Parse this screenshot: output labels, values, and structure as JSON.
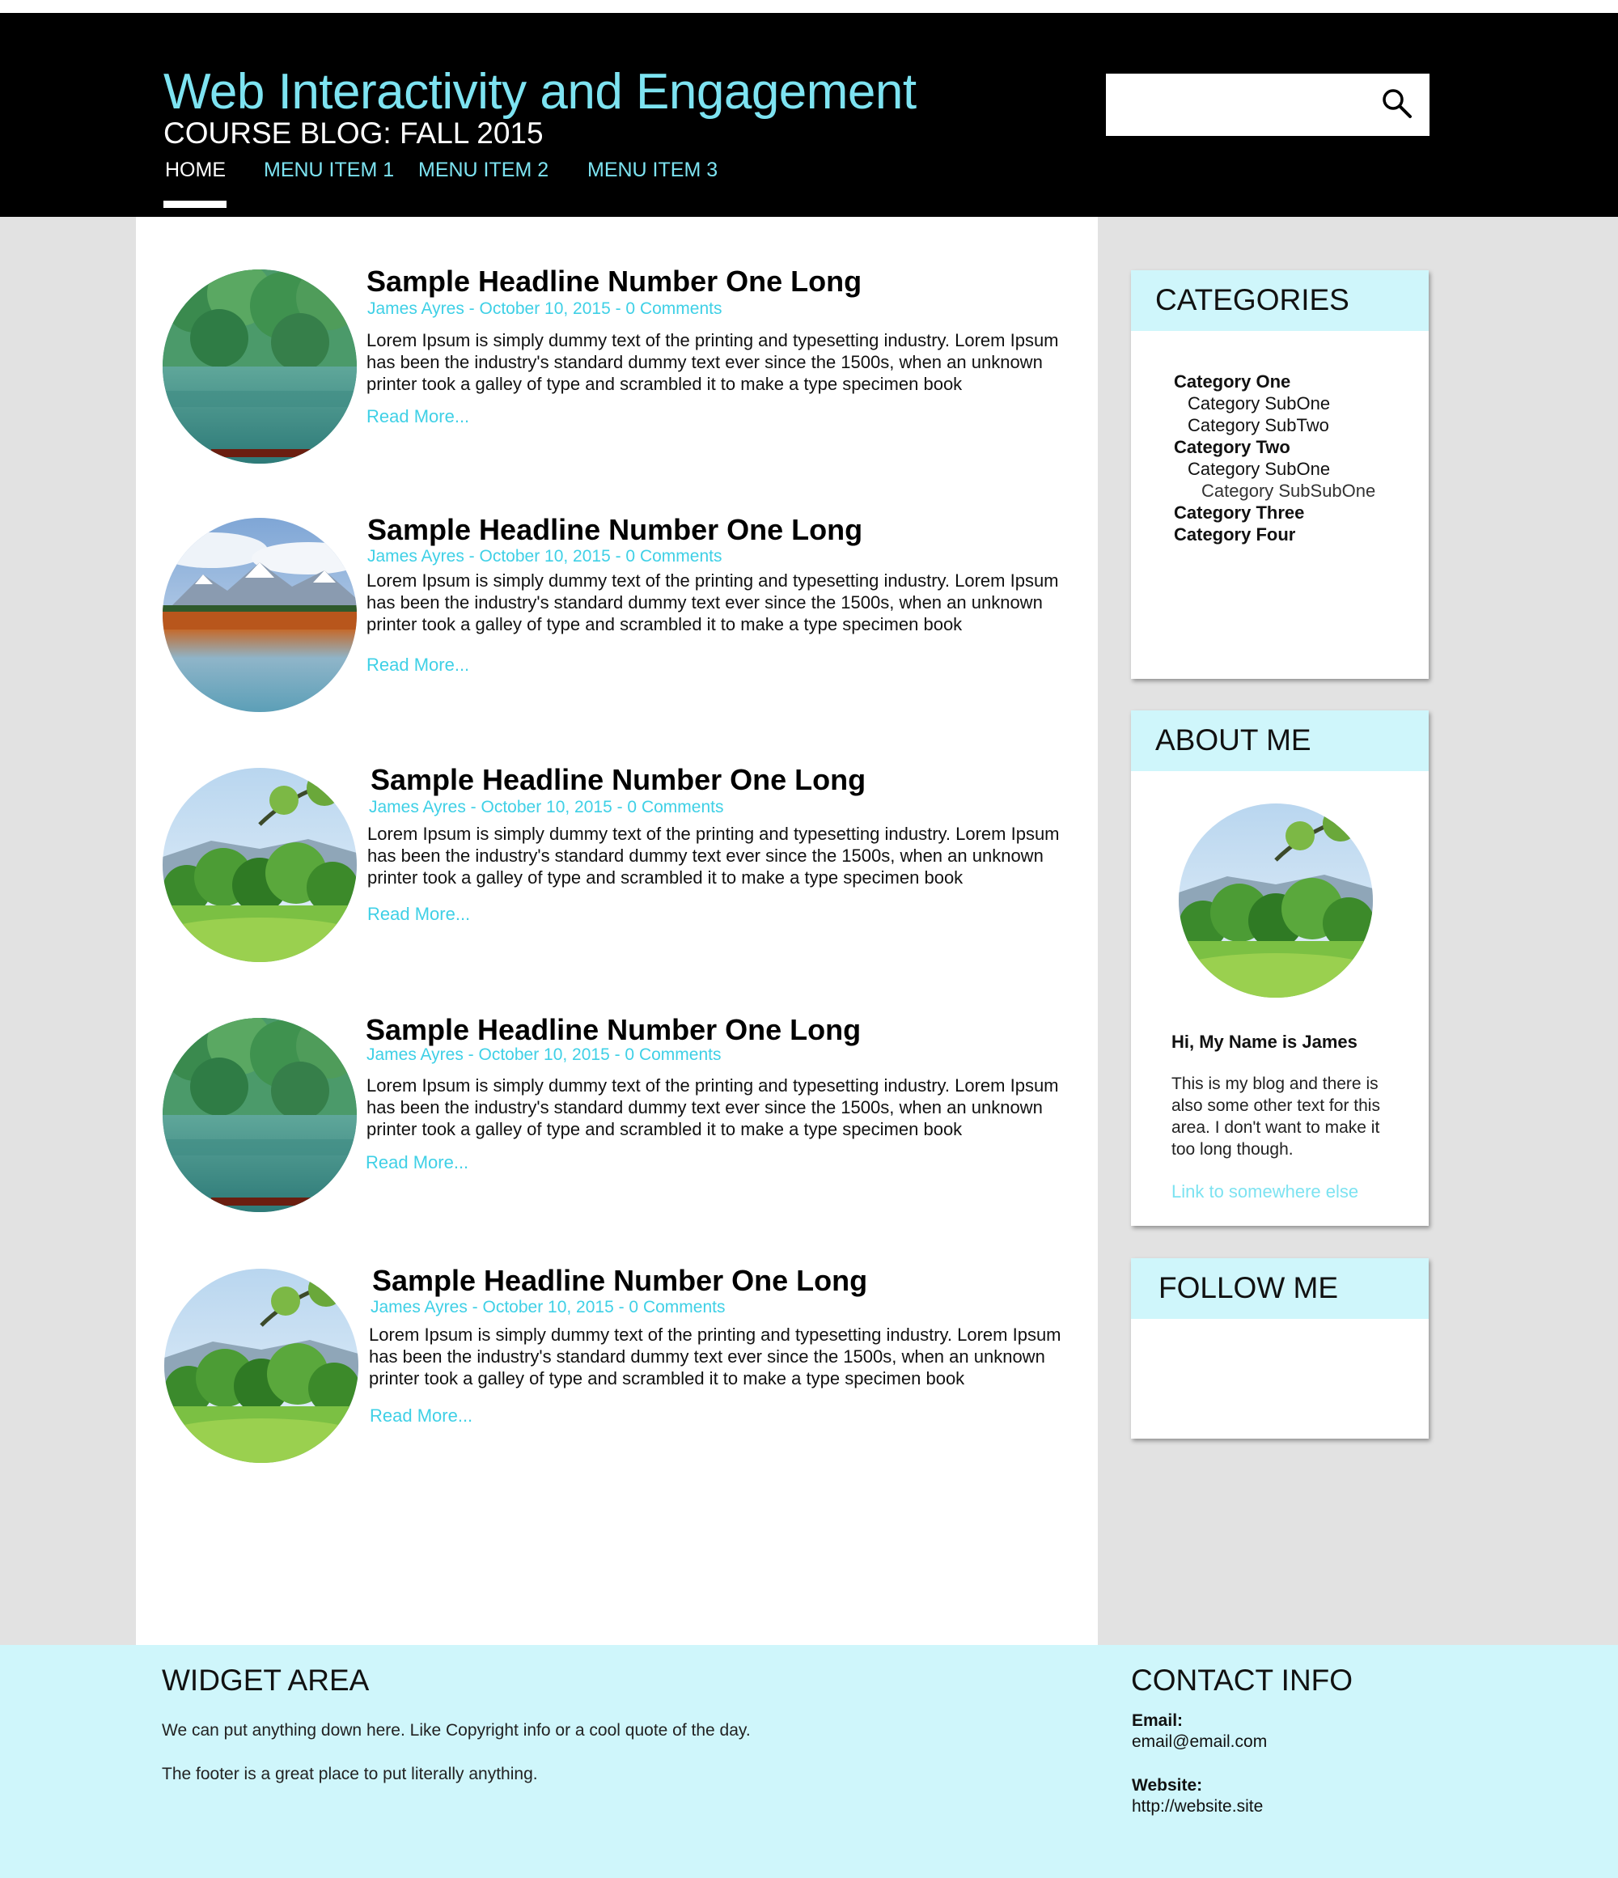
{
  "header": {
    "title": "Web Interactivity and Engagement",
    "subtitle": "COURSE BLOG: FALL 2015",
    "search": {
      "placeholder": "",
      "icon": "search-icon"
    }
  },
  "nav": {
    "items": [
      {
        "label": "HOME",
        "active": true
      },
      {
        "label": "MENU ITEM 1",
        "active": false
      },
      {
        "label": "MENU ITEM 2",
        "active": false
      },
      {
        "label": "MENU ITEM 3",
        "active": false
      }
    ]
  },
  "posts": [
    {
      "title": "Sample Headline Number One Long",
      "meta": "James Ayres - October 10, 2015 - 0 Comments",
      "excerpt": "Lorem Ipsum is simply dummy text of the printing and typesetting industry. Lorem Ipsum has been the industry's standard dummy text ever since the 1500s, when an unknown printer took a galley of type and scrambled it to make a type specimen book",
      "read_more": "Read More...",
      "image": "lake-forest"
    },
    {
      "title": "Sample Headline Number One Long",
      "meta": "James Ayres - October 10, 2015 - 0 Comments",
      "excerpt": "Lorem Ipsum is simply dummy text of the printing and typesetting industry. Lorem Ipsum has been the industry's standard dummy text ever since the 1500s, when an unknown printer took a galley of type and scrambled it to make a type specimen book",
      "read_more": "Read More...",
      "image": "mountain-lake"
    },
    {
      "title": "Sample Headline Number One Long",
      "meta": "James Ayres - October 10, 2015 - 0 Comments",
      "excerpt": "Lorem Ipsum is simply dummy text of the printing and typesetting industry. Lorem Ipsum has been the industry's standard dummy text ever since the 1500s, when an unknown printer took a galley of type and scrambled it to make a type specimen book",
      "read_more": "Read More...",
      "image": "green-meadow"
    },
    {
      "title": "Sample Headline Number One Long",
      "meta": "James Ayres - October 10, 2015 - 0 Comments",
      "excerpt": "Lorem Ipsum is simply dummy text of the printing and typesetting industry. Lorem Ipsum has been the industry's standard dummy text ever since the 1500s, when an unknown printer took a galley of type and scrambled it to make a type specimen book",
      "read_more": "Read More...",
      "image": "lake-forest"
    },
    {
      "title": "Sample Headline Number One Long",
      "meta": "James Ayres - October 10, 2015 - 0 Comments",
      "excerpt": "Lorem Ipsum is simply dummy text of the printing and typesetting industry. Lorem Ipsum has been the industry's standard dummy text ever since the 1500s, when an unknown printer took a galley of type and scrambled it to make a type specimen book",
      "read_more": "Read More...",
      "image": "green-meadow"
    }
  ],
  "sidebar": {
    "categories": {
      "title": "CATEGORIES",
      "items": [
        {
          "label": "Category One",
          "level": 1
        },
        {
          "label": "Category SubOne",
          "level": 2
        },
        {
          "label": "Category SubTwo",
          "level": 2
        },
        {
          "label": "Category Two",
          "level": 1
        },
        {
          "label": "Category SubOne",
          "level": 2
        },
        {
          "label": "Category SubSubOne",
          "level": 3
        },
        {
          "label": "Category Three",
          "level": 1
        },
        {
          "label": "Category Four",
          "level": 1
        }
      ]
    },
    "about": {
      "title": "ABOUT ME",
      "name": "Hi, My Name is James",
      "text": "This is my blog and there is also some other text for this area. I don't want to make it too long though.",
      "link": "Link to somewhere else",
      "image": "green-meadow"
    },
    "follow": {
      "title": "FOLLOW ME"
    }
  },
  "footer": {
    "widget": {
      "title": "WIDGET AREA",
      "line1": "We can put anything down here. Like Copyright info or a cool quote of the day.",
      "line2": "The footer is a great place to put literally anything."
    },
    "contact": {
      "title": "CONTACT INFO",
      "email_label": "Email:",
      "email": "email@email.com",
      "website_label": "Website:",
      "website": "http://website.site"
    }
  },
  "colors": {
    "accent": "#7de3f1",
    "link": "#3fd0e6",
    "light_accent": "#cff6fb",
    "header_bg": "#000000",
    "page_bg": "#e2e2e2"
  }
}
